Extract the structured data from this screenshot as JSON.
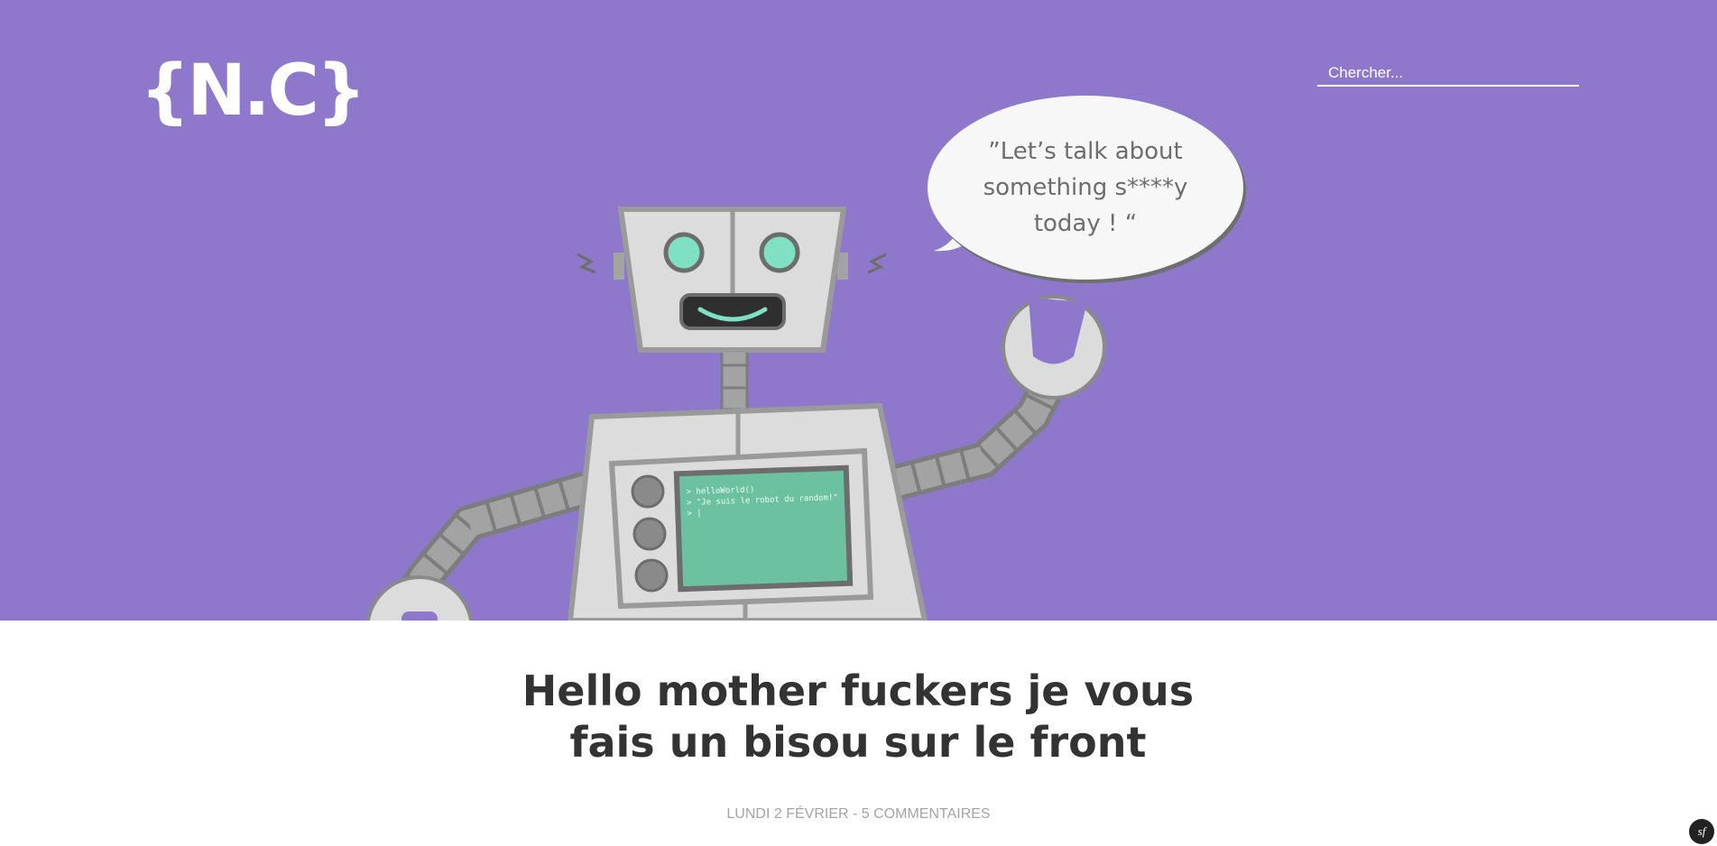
{
  "header": {
    "logo_text": "{N.C}",
    "search_placeholder": "Chercher..."
  },
  "hero": {
    "bubble_text": "”Let’s talk about something s****y today ! “",
    "terminal_lines": [
      "> helloWorld()",
      "> \"Je suis le robot du random!\"",
      "> |"
    ],
    "colors": {
      "background": "#8e78cb",
      "robot_body": "#dcdcdc",
      "robot_frame": "#9a9a9a",
      "eyes": "#7fe0c4",
      "screen": "#6cc2a0"
    }
  },
  "post": {
    "title": "Hello mother fuckers je vous fais un bisou sur le front",
    "meta": "LUNDI 2 FÉVRIER - 5 COMMENTAIRES"
  },
  "debug_badge": {
    "label": "sf"
  }
}
